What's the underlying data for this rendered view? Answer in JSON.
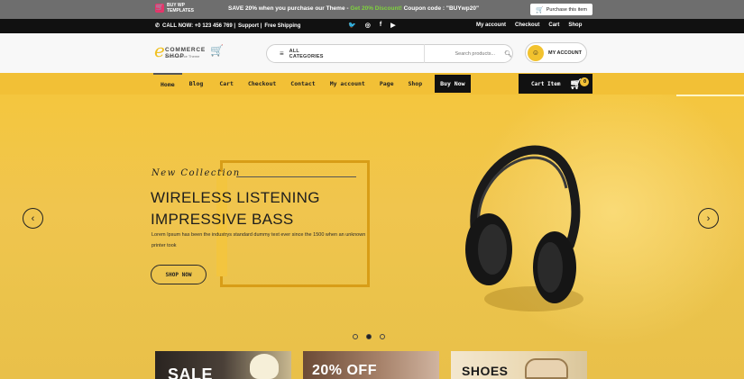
{
  "promo": {
    "logo_text": "BUY WP TEMPLATES",
    "offer_prefix": "SAVE 20% when you purchase our Theme - ",
    "offer_highlight": "Get 20% Discount!",
    "offer_suffix": " Coupon code : \"BUYwp20\"",
    "purchase_label": "Purchase this item"
  },
  "info": {
    "call": "CALL NOW: +0 123 456 769 |",
    "support": "Support |",
    "shipping": "Free Shipping",
    "links": [
      "My account",
      "Checkout",
      "Cart",
      "Shop"
    ]
  },
  "header": {
    "brand_name": "COMMERCE SHOP",
    "brand_tag": "A Ecommerce Theme",
    "categories_label": "ALL CATEGORIES",
    "search_placeholder": "Search products...",
    "account_label": "MY ACCOUNT"
  },
  "nav": {
    "items": [
      "Home",
      "Blog",
      "Cart",
      "Checkout",
      "Contact",
      "My account",
      "Page",
      "Shop"
    ],
    "buy_now": "Buy Now",
    "cart_label": "Cart Item",
    "cart_count": "0"
  },
  "hero": {
    "eyebrow": "New Collection",
    "headline_line1": "WIRELESS LISTENING",
    "headline_line2": "IMPRESSIVE BASS",
    "body": "Lorem Ipsum has been the industrys standard dummy text ever since the 1500 when an unknown printer took",
    "cta": "SHOP NOW",
    "slides_total": 3,
    "active_slide": 2
  },
  "cards": [
    "SALE",
    "20% OFF",
    "SHOES"
  ],
  "colors": {
    "accent": "#f2c036",
    "dark": "#111111",
    "promo_bar": "#6e6e6e"
  }
}
